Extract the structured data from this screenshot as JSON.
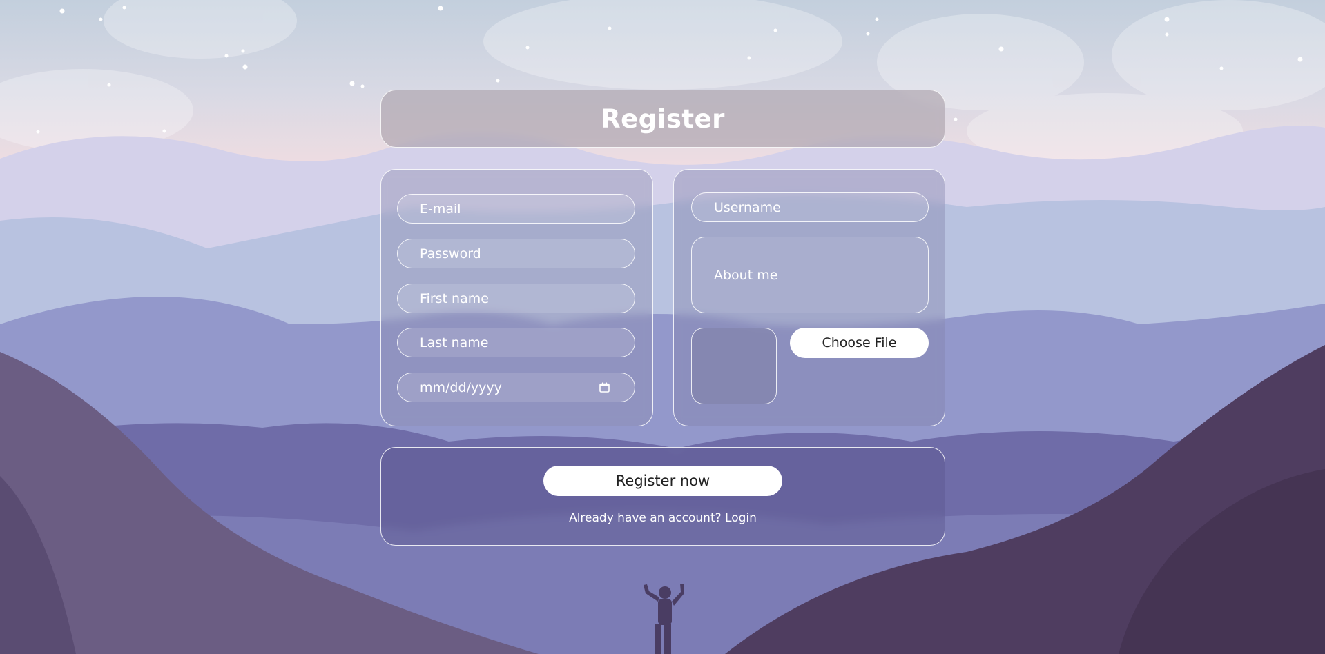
{
  "header": {
    "title": "Register"
  },
  "left_form": {
    "email_placeholder": "E-mail",
    "password_placeholder": "Password",
    "first_name_placeholder": "First name",
    "last_name_placeholder": "Last name",
    "date_placeholder": "mm/dd/yyyy",
    "date_icon": "calendar-icon"
  },
  "right_form": {
    "username_placeholder": "Username",
    "about_placeholder": "About me",
    "file_button_label": "Choose File"
  },
  "footer": {
    "register_button_label": "Register now",
    "login_prompt": "Already have an account? Login"
  },
  "colors": {
    "sky_top": "#c7d1df",
    "sky_pink": "#f1dde1",
    "mountain_light": "#b7c2e1",
    "mountain_mid": "#8e93c6",
    "mountain_dark": "#6b5d83",
    "hill_darkest": "#483657",
    "button_bg": "#ffffff",
    "text_light": "#ffffff"
  }
}
